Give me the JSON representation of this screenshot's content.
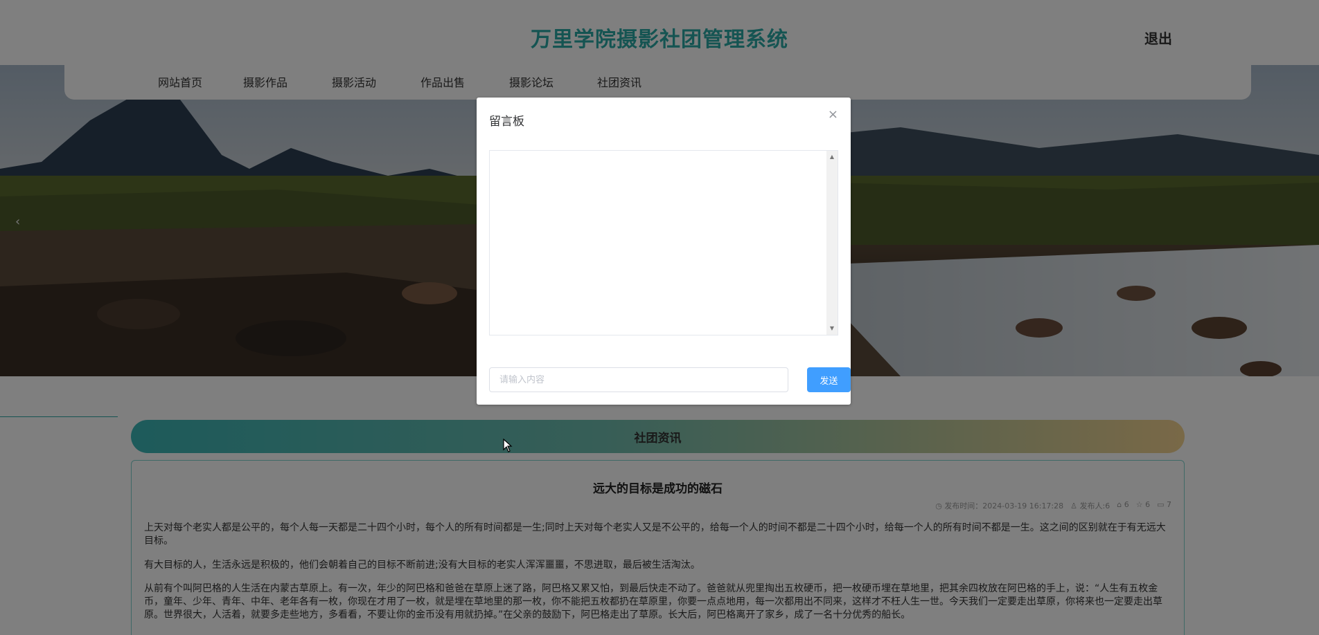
{
  "header": {
    "site_title": "万里学院摄影社团管理系统",
    "logout_label": "退出"
  },
  "nav": {
    "items": [
      {
        "label": "网站首页"
      },
      {
        "label": "摄影作品"
      },
      {
        "label": "摄影活动"
      },
      {
        "label": "作品出售"
      },
      {
        "label": "摄影论坛"
      },
      {
        "label": "社团资讯"
      }
    ]
  },
  "section": {
    "title": "社团资讯"
  },
  "article": {
    "title": "远大的目标是成功的磁石",
    "meta": {
      "publish_time": "发布时间：2024-03-19 16:17:28",
      "publisher": "发布人:6",
      "likes": "6",
      "favorites": "6",
      "comments": "7"
    },
    "paragraphs": [
      "上天对每个老实人都是公平的，每个人每一天都是二十四个小时，每个人的所有时间都是一生;同时上天对每个老实人又是不公平的，给每一个人的时间不都是二十四个小时，给每一个人的所有时间不都是一生。这之间的区别就在于有无远大目标。",
      "有大目标的人，生活永远是积极的，他们会朝着自己的目标不断前进;没有大目标的老实人浑浑噩噩，不思进取，最后被生活淘汰。",
      "从前有个叫阿巴格的人生活在内蒙古草原上。有一次，年少的阿巴格和爸爸在草原上迷了路，阿巴格又累又怕，到最后快走不动了。爸爸就从兜里掏出五枚硬币，把一枚硬币埋在草地里，把其余四枚放在阿巴格的手上，说：“人生有五枚金币，童年、少年、青年、中年、老年各有一枚，你现在才用了一枚，就是埋在草地里的那一枚，你不能把五枚都扔在草原里，你要一点点地用，每一次都用出不同来，这样才不枉人生一世。今天我们一定要走出草原，你将来也一定要走出草原。世界很大，人活着，就要多走些地方，多看看，不要让你的金币没有用就扔掉。”在父亲的鼓励下，阿巴格走出了草原。长大后，阿巴格离开了家乡，成了一名十分优秀的船长。"
    ]
  },
  "dialog": {
    "title": "留言板",
    "input_placeholder": "请输入内容",
    "send_label": "发送"
  },
  "icons": {
    "close": "close-icon",
    "clock": "clock-icon",
    "user": "user-icon",
    "like": "thumb-up-icon",
    "favorite": "star-icon",
    "comment": "comment-icon"
  },
  "colors": {
    "brand": "#2aa9a5",
    "primary_button": "#409eff"
  }
}
